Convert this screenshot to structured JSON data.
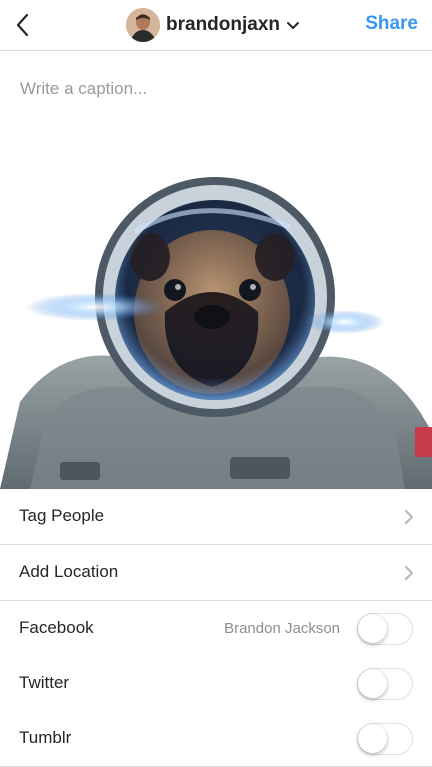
{
  "header": {
    "username": "brandonjaxn",
    "share_label": "Share",
    "back_icon": "chevron-left-icon",
    "dropdown_icon": "chevron-down-icon",
    "accent_color": "#3897f0"
  },
  "caption": {
    "placeholder": "Write a caption...",
    "value": ""
  },
  "photo": {
    "subject": "pug in astronaut suit"
  },
  "options": {
    "tag_people": "Tag People",
    "add_location": "Add Location"
  },
  "share_to": [
    {
      "label": "Facebook",
      "value": "Brandon Jackson",
      "enabled": false
    },
    {
      "label": "Twitter",
      "value": "",
      "enabled": false
    },
    {
      "label": "Tumblr",
      "value": "",
      "enabled": false
    }
  ]
}
